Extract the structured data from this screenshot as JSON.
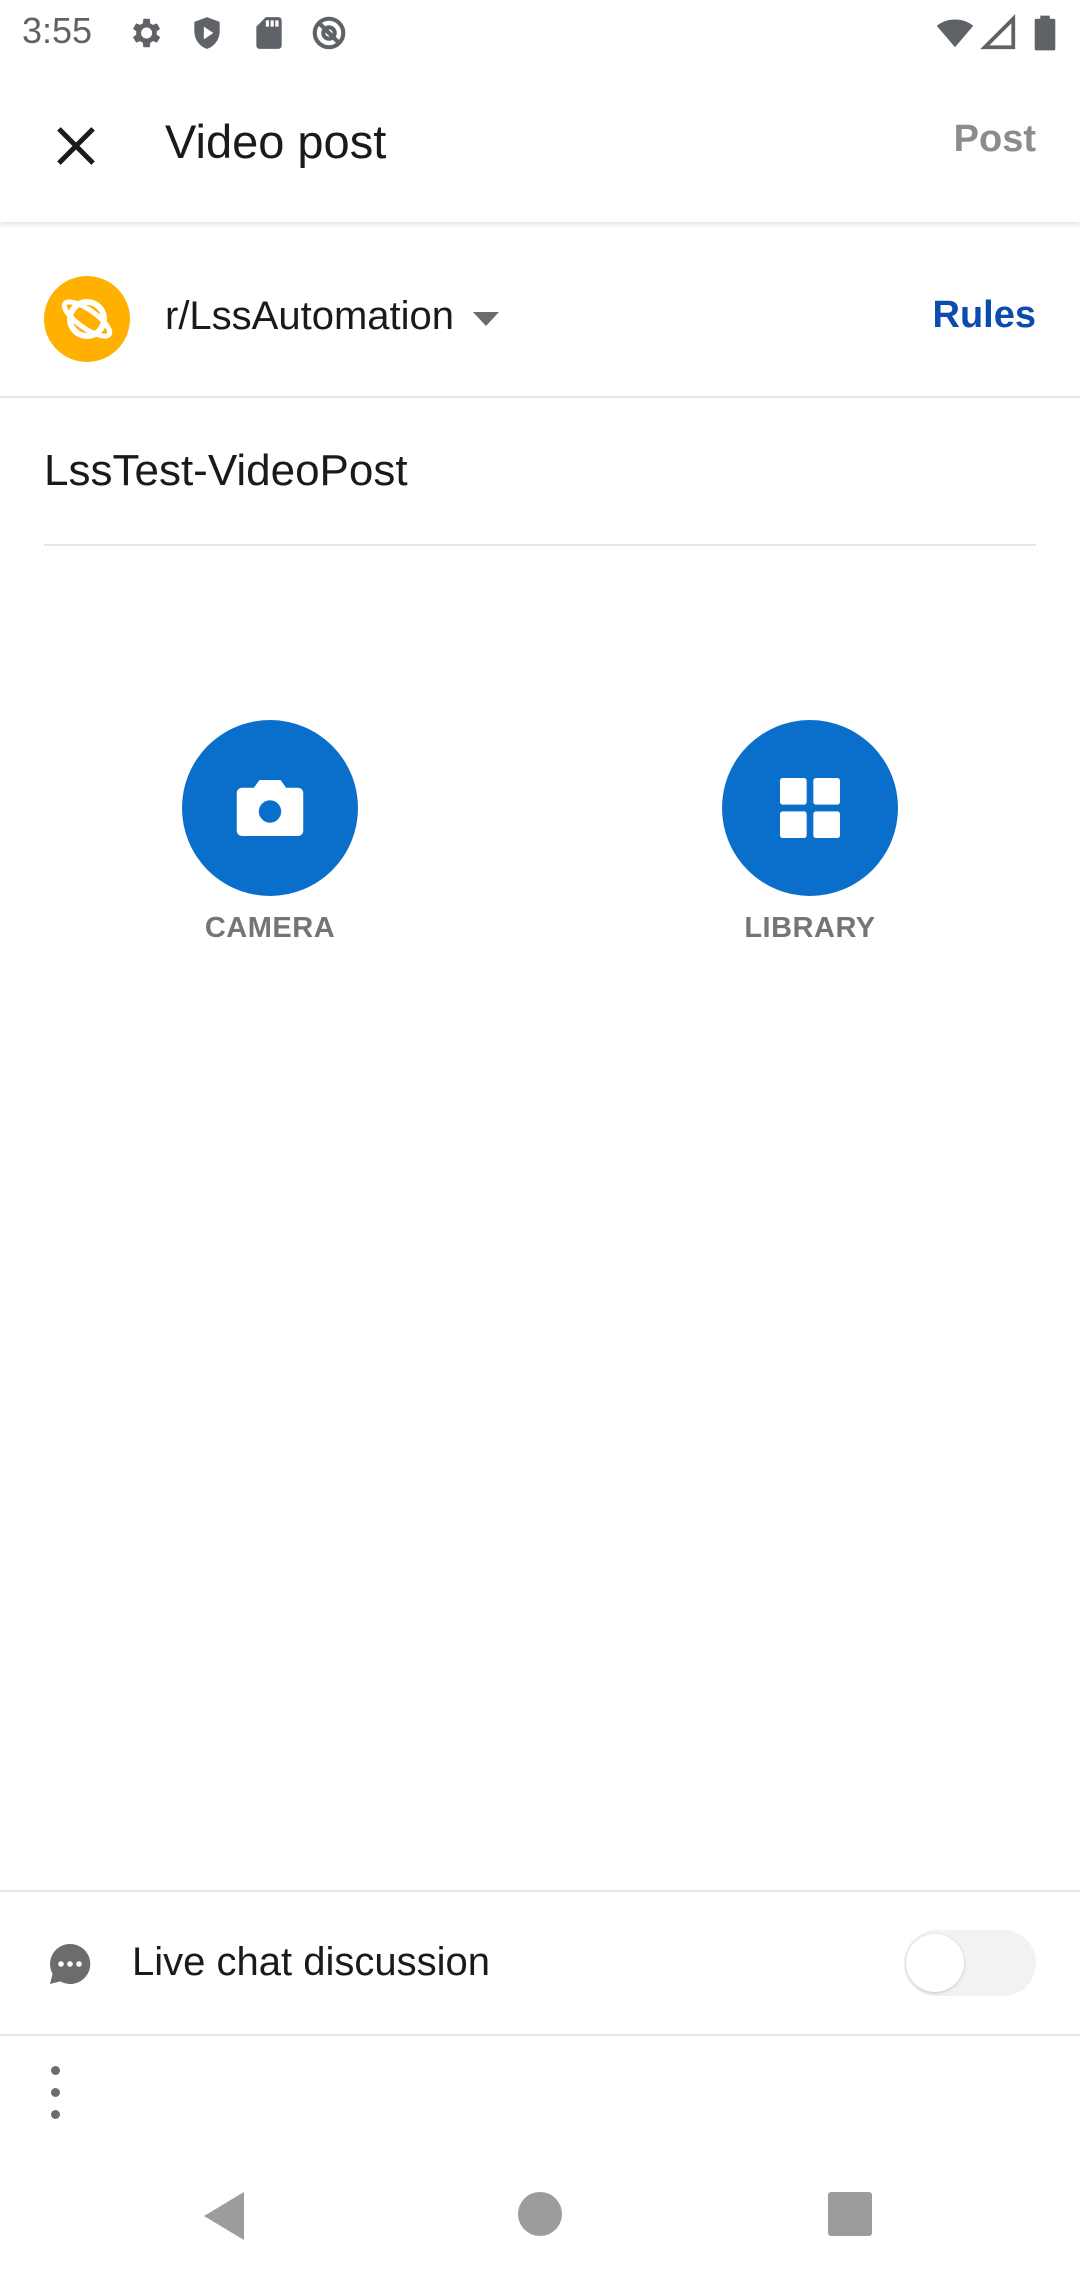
{
  "status_bar": {
    "time": "3:55",
    "icons": [
      "settings-icon",
      "shield-icon",
      "sd-card-icon",
      "at-sign-icon",
      "wifi-icon",
      "signal-icon",
      "battery-icon"
    ]
  },
  "header": {
    "title": "Video post",
    "post_label": "Post",
    "close_icon": "close-icon"
  },
  "community": {
    "name": "r/LssAutomation",
    "rules_label": "Rules",
    "avatar_color": "#ffb000"
  },
  "post": {
    "title": "LssTest-VideoPost"
  },
  "media": {
    "camera_label": "CAMERA",
    "library_label": "LIBRARY",
    "accent": "#0a6fca"
  },
  "bottom": {
    "live_chat_label": "Live chat discussion",
    "live_chat_enabled": false
  },
  "nav": {
    "items": [
      "back-icon",
      "home-icon",
      "recents-icon"
    ]
  }
}
